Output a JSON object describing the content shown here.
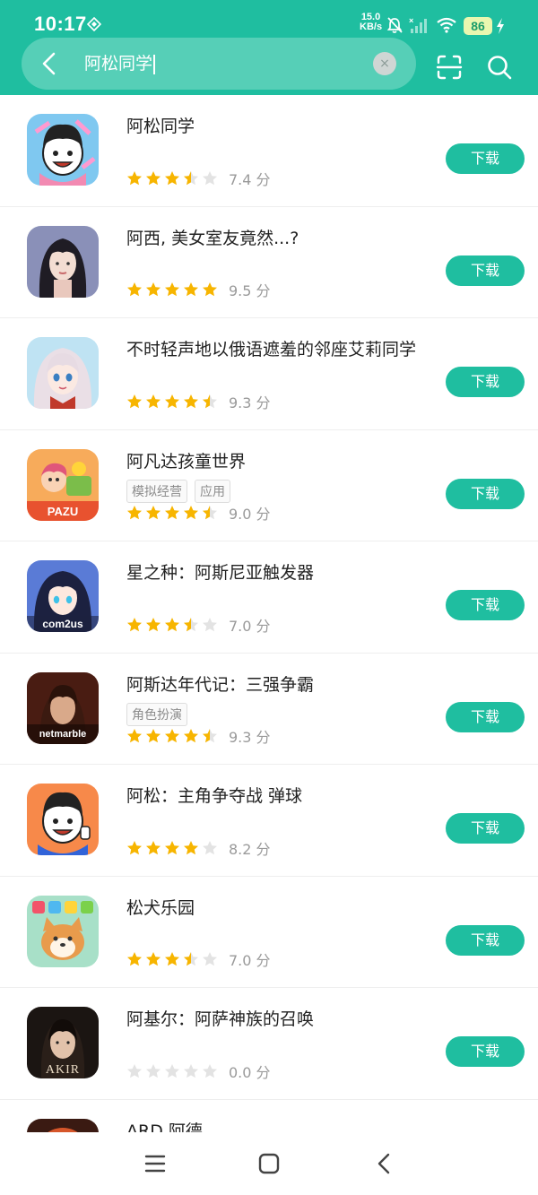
{
  "status": {
    "time": "10:17",
    "net_speed_value": "15.0",
    "net_speed_unit": "KB/s",
    "battery": "86"
  },
  "search": {
    "query": "阿松同学",
    "clear_label": "×"
  },
  "download_label": "下载",
  "score_unit": "分",
  "apps": [
    {
      "name": "阿松同学",
      "tags": [],
      "score": "7.4",
      "stars": 3.5
    },
    {
      "name": "阿西, 美女室友竟然...?",
      "tags": [],
      "score": "9.5",
      "stars": 5
    },
    {
      "name": "不时轻声地以俄语遮羞的邻座艾莉同学",
      "tags": [],
      "score": "9.3",
      "stars": 4.5
    },
    {
      "name": "阿凡达孩童世界",
      "tags": [
        "模拟经营",
        "应用"
      ],
      "score": "9.0",
      "stars": 4.5
    },
    {
      "name": "星之种：阿斯尼亚触发器",
      "tags": [],
      "score": "7.0",
      "stars": 3.5
    },
    {
      "name": "阿斯达年代记：三强争霸",
      "tags": [
        "角色扮演"
      ],
      "score": "9.3",
      "stars": 4.5
    },
    {
      "name": "阿松：主角争夺战 弹球",
      "tags": [],
      "score": "8.2",
      "stars": 4
    },
    {
      "name": "松犬乐园",
      "tags": [],
      "score": "7.0",
      "stars": 3.5
    },
    {
      "name": "阿基尔：阿萨神族的召唤",
      "tags": [],
      "score": "0.0",
      "stars": 0
    },
    {
      "name": "ARD 阿德",
      "tags": [],
      "score": "",
      "stars": 0
    }
  ],
  "icon_text": {
    "pazu": "PAZU",
    "com2us": "com2us",
    "netmarble": "netmarble",
    "akir": "AKIR"
  },
  "colors": {
    "accent": "#1fbea0",
    "star_filled": "#f7b500",
    "star_empty": "#e3e3e3"
  }
}
